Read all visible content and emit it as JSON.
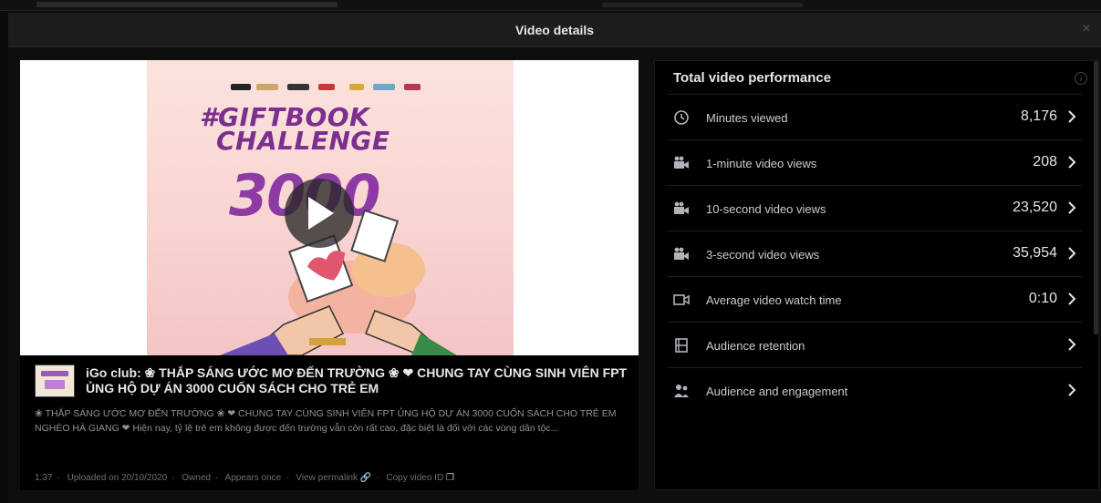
{
  "dialog": {
    "title": "Video details",
    "close_label": "×"
  },
  "video": {
    "poster_hashtag_line1": "#GIFTBOOK",
    "poster_hashtag_line2": "CHALLENGE",
    "poster_number": "3000",
    "title": "iGo club: ❀ THẮP SÁNG ƯỚC MƠ ĐẾN TRƯỜNG ❀ ❤ CHUNG TAY CÙNG SINH VIÊN FPT ỦNG HỘ DỰ ÁN 3000 CUỐN SÁCH CHO TRẺ EM",
    "description": "❀ THẮP SÁNG ƯỚC MƠ ĐẾN TRƯỜNG ❀ ❤ CHUNG TAY CÙNG SINH VIÊN FPT ỦNG HỘ DỰ ÁN 3000 CUỐN SÁCH CHO TRẺ EM NGHÈO HÀ GIANG ❤ Hiện nay, tỷ lệ trẻ em không được đến trường vẫn còn rất cao, đặc biệt là đối với các vùng dân tộc...",
    "footer": {
      "duration": "1:37",
      "uploaded": "Uploaded on 20/10/2020",
      "owned": "Owned",
      "appears": "Appears once",
      "permalink": "View permalink",
      "copy_id": "Copy video ID"
    }
  },
  "performance": {
    "header": "Total video performance",
    "info_label": "i",
    "rows": [
      {
        "label": "Minutes viewed",
        "value": "8,176",
        "icon": "clock-icon"
      },
      {
        "label": "1-minute video views",
        "value": "208",
        "icon": "video-views-icon"
      },
      {
        "label": "10-second video views",
        "value": "23,520",
        "icon": "video-views-icon"
      },
      {
        "label": "3-second video views",
        "value": "35,954",
        "icon": "video-views-icon"
      },
      {
        "label": "Average video watch time",
        "value": "0:10",
        "icon": "video-camera-icon"
      },
      {
        "label": "Audience retention",
        "value": "",
        "icon": "film-strip-icon"
      },
      {
        "label": "Audience and engagement",
        "value": "",
        "icon": "people-icon"
      }
    ]
  },
  "colors": {
    "background": "#000000",
    "panel": "#0e0e0e",
    "poster_purple": "#8e3aa4",
    "poster_bg": "#f8d4d1"
  }
}
